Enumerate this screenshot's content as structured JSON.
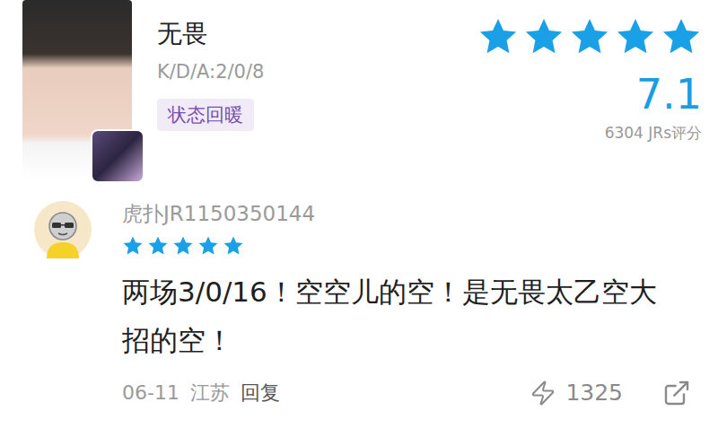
{
  "player": {
    "name": "无畏",
    "kda": "K/D/A:2/0/8",
    "tag": "状态回暖",
    "stars": 5,
    "score": "7.1",
    "rating_count": "6304 JRs评分"
  },
  "comment": {
    "username": "虎扑JR1150350144",
    "stars": 5,
    "text": "两场3/0/16！空空儿的空！是无畏太乙空大招的空！",
    "date": "06-11",
    "location": "江苏",
    "reply": "回复",
    "likes": "1325"
  }
}
